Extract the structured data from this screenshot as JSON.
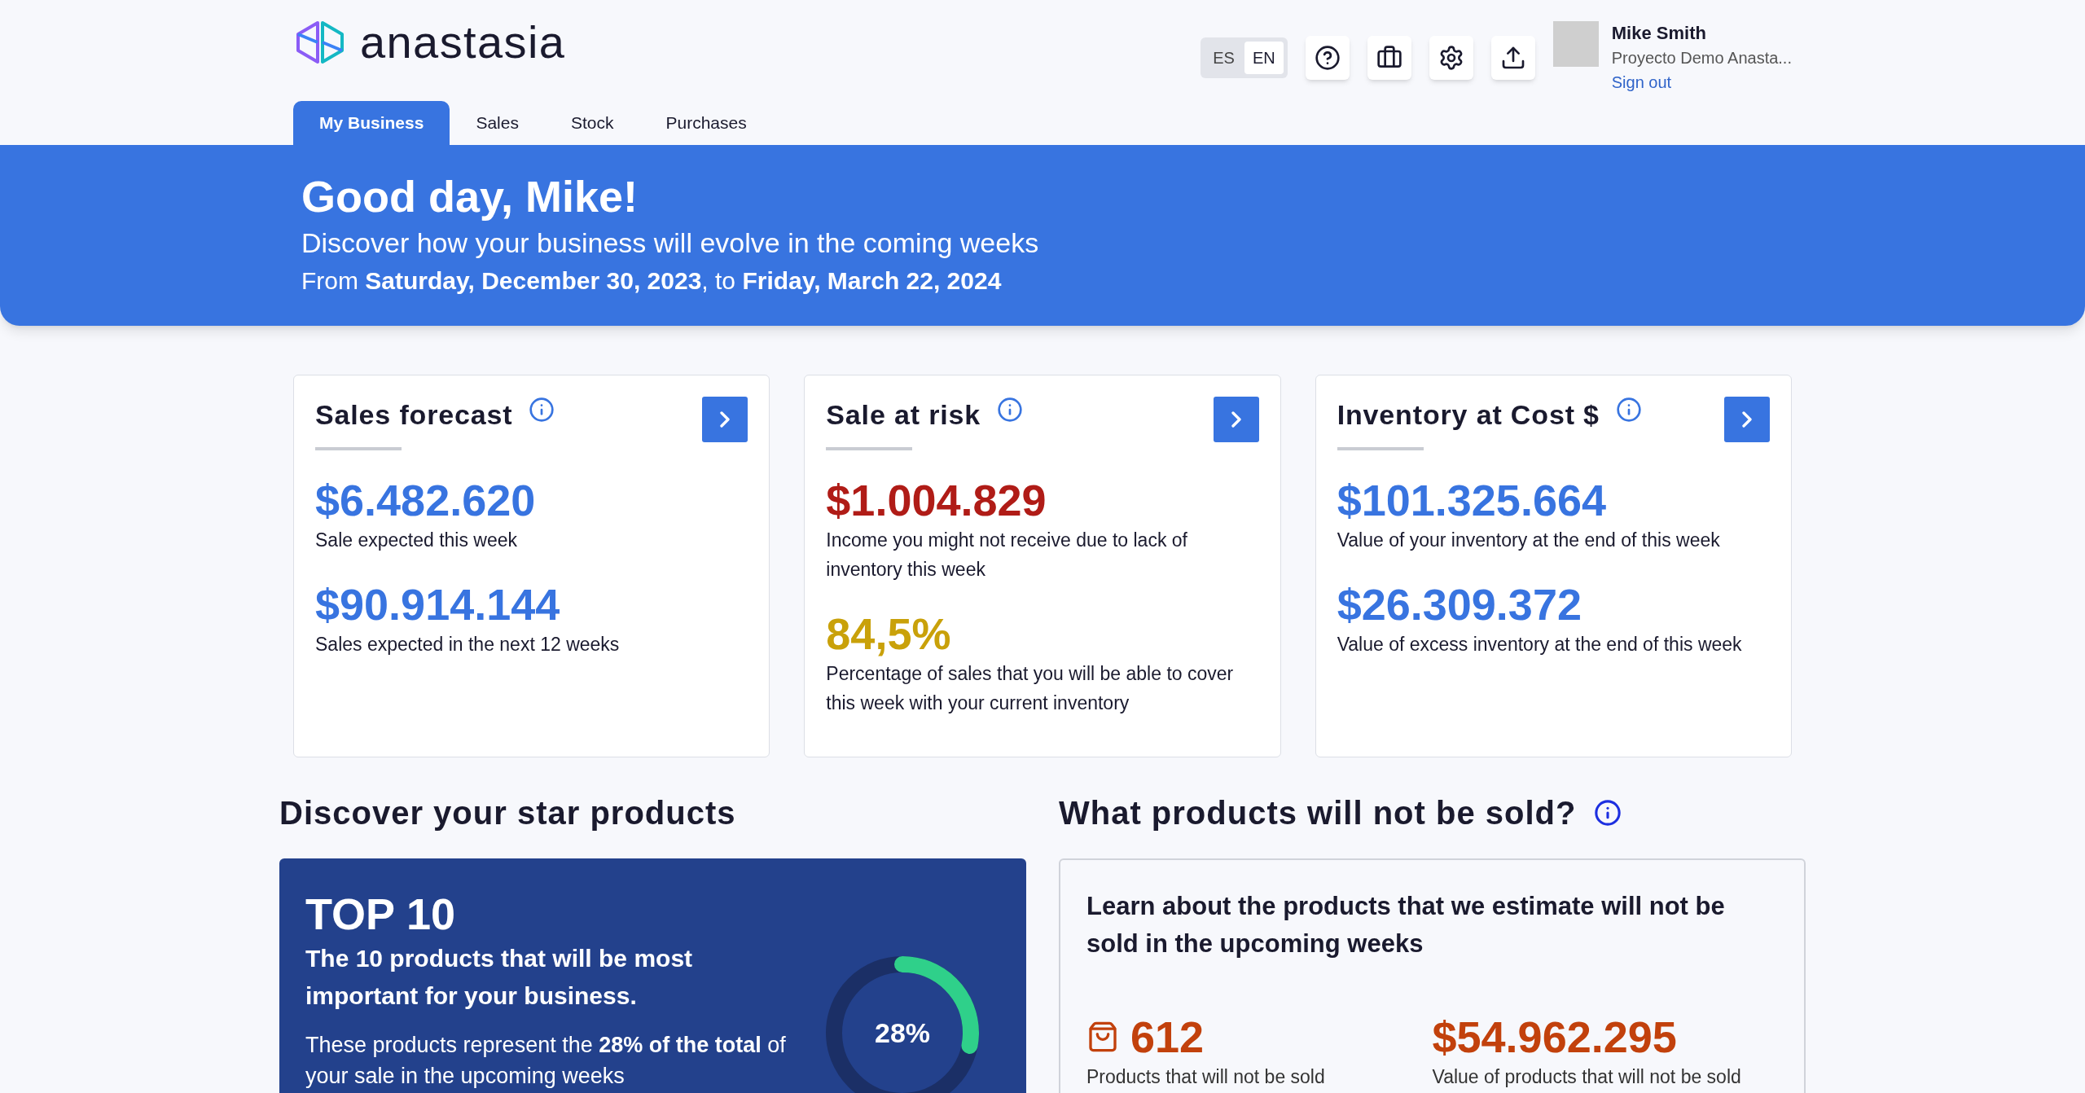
{
  "header": {
    "logo_text": "anastasia",
    "languages": [
      {
        "label": "ES",
        "selected": false
      },
      {
        "label": "EN",
        "selected": true
      }
    ],
    "user": {
      "name": "Mike Smith",
      "project": "Proyecto Demo Anasta...",
      "sign_out": "Sign out"
    }
  },
  "tabs": [
    {
      "label": "My Business",
      "selected": true
    },
    {
      "label": "Sales",
      "selected": false
    },
    {
      "label": "Stock",
      "selected": false
    },
    {
      "label": "Purchases",
      "selected": false
    }
  ],
  "banner": {
    "greeting": "Good day, Mike!",
    "subtitle": "Discover how your business will evolve in the coming weeks",
    "dates": "From **Saturday, December 30, 2023**, to **Friday, March 22, 2024**"
  },
  "cards": [
    {
      "title": "Sales forecast",
      "metrics": [
        {
          "value": "$6.482.620",
          "color": "#3874e0",
          "caption": "Sale expected this week"
        },
        {
          "value": "$90.914.144",
          "color": "#3874e0",
          "caption": "Sales expected in the next 12 weeks"
        }
      ]
    },
    {
      "title": "Sale at risk",
      "metrics": [
        {
          "value": "$1.004.829",
          "color": "#b01c17",
          "caption": "Income you might not receive due to lack of inventory this week"
        },
        {
          "value": "84,5%",
          "color": "#c9a10a",
          "caption": "Percentage of sales that you will be able to cover this week with your current inventory"
        }
      ]
    },
    {
      "title": "Inventory at Cost $",
      "metrics": [
        {
          "value": "$101.325.664",
          "color": "#3874e0",
          "caption": "Value of your inventory at the end of this week"
        },
        {
          "value": "$26.309.372",
          "color": "#3874e0",
          "caption": "Value of excess inventory at the end of this week"
        }
      ]
    }
  ],
  "star_products": {
    "heading": "Discover your star products",
    "title": "TOP 10",
    "subtitle": "The 10 products that will be most important for your business.",
    "text": "These products represent the **28% of the total** of your sale in the upcoming weeks",
    "donut": {
      "level": 0.28,
      "label": "28%"
    }
  },
  "not_sold": {
    "heading": "What products will not be sold?",
    "intro": "Learn about the products that we estimate will not be sold in the upcoming weeks",
    "stats": [
      {
        "value": "612",
        "caption": "Products that will not be sold"
      },
      {
        "value": "$54.962.295",
        "caption": "Value of products that will not be sold"
      }
    ]
  }
}
